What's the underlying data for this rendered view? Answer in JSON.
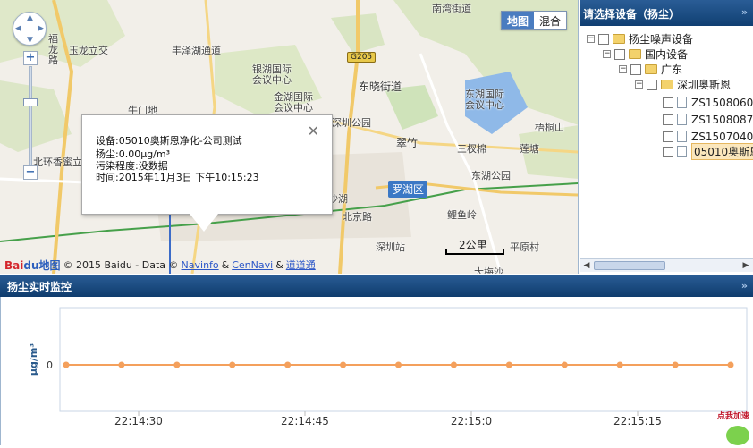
{
  "map": {
    "labels": {
      "nanwan": "南湾街道",
      "fulong": "福\n龙\n路",
      "yulong": "玉龙立交",
      "nize": "丰泽湖通道",
      "yinhu": "银湖国际\n会议中心",
      "jinhu": "金湖国际\n会议中心",
      "dongxiao": "东晓街道",
      "donghu_intl": "东湖国际\n会议中心",
      "niuzhi": "牛门地",
      "shenzhen_park": "深圳公园",
      "cuizhu": "翠竹",
      "sanchacha": "三杈棉",
      "lianhu": "莲塘",
      "wutong": "梧桐山",
      "dongji_park": "东湖公园",
      "beihuan": "北环香蜜立",
      "leiyuling": "鲤鱼岭",
      "shenzhen_station": "深圳站",
      "pingyuan": "平原村",
      "dameisha": "大梅沙",
      "shahu": "沙湖",
      "beijing_rd": "北京路"
    },
    "district": "罗湖区",
    "road_shield": "G205",
    "map_type": {
      "map": "地图",
      "hybrid": "混合"
    },
    "info_window": {
      "device": "设备:05010奥斯恩净化-公司测试",
      "dust": "扬尘:0.00μg/m³",
      "pollution": "污染程度:没数据",
      "time": "时间:2015年11月3日 下午10:15:23"
    },
    "scale": "2公里",
    "copyright": {
      "logo_bai": "Bai",
      "logo_du": "du",
      "logo_map": "地图",
      "text": "© 2015 Baidu - Data ©",
      "navinfo": "Navinfo",
      "amp1": "&",
      "cennavi": "CenNavi",
      "amp2": "&",
      "daodaotong": "道道通"
    }
  },
  "panel": {
    "title": "请选择设备（扬尘）",
    "tree": [
      {
        "label": "扬尘噪声设备"
      },
      {
        "label": "国内设备"
      },
      {
        "label": "广东"
      },
      {
        "label": "深圳奥斯恩"
      },
      {
        "label": "ZS1508060"
      },
      {
        "label": "ZS1508087"
      },
      {
        "label": "ZS1507040"
      },
      {
        "label": "05010奥斯恩"
      }
    ]
  },
  "monitor": {
    "title": "扬尘实时监控"
  },
  "chart_data": {
    "type": "line",
    "ylabel": "μg/m³",
    "yticks": [
      "0"
    ],
    "xticks": [
      "22:14:30",
      "22:14:45",
      "22:15:0",
      "22:15:15"
    ],
    "series": [
      {
        "values": [
          0,
          0,
          0,
          0,
          0,
          0,
          0,
          0,
          0,
          0,
          0,
          0,
          0
        ]
      }
    ],
    "line_color": "#f4a05c",
    "grid": true
  },
  "ad": {
    "text": "点我加速"
  }
}
